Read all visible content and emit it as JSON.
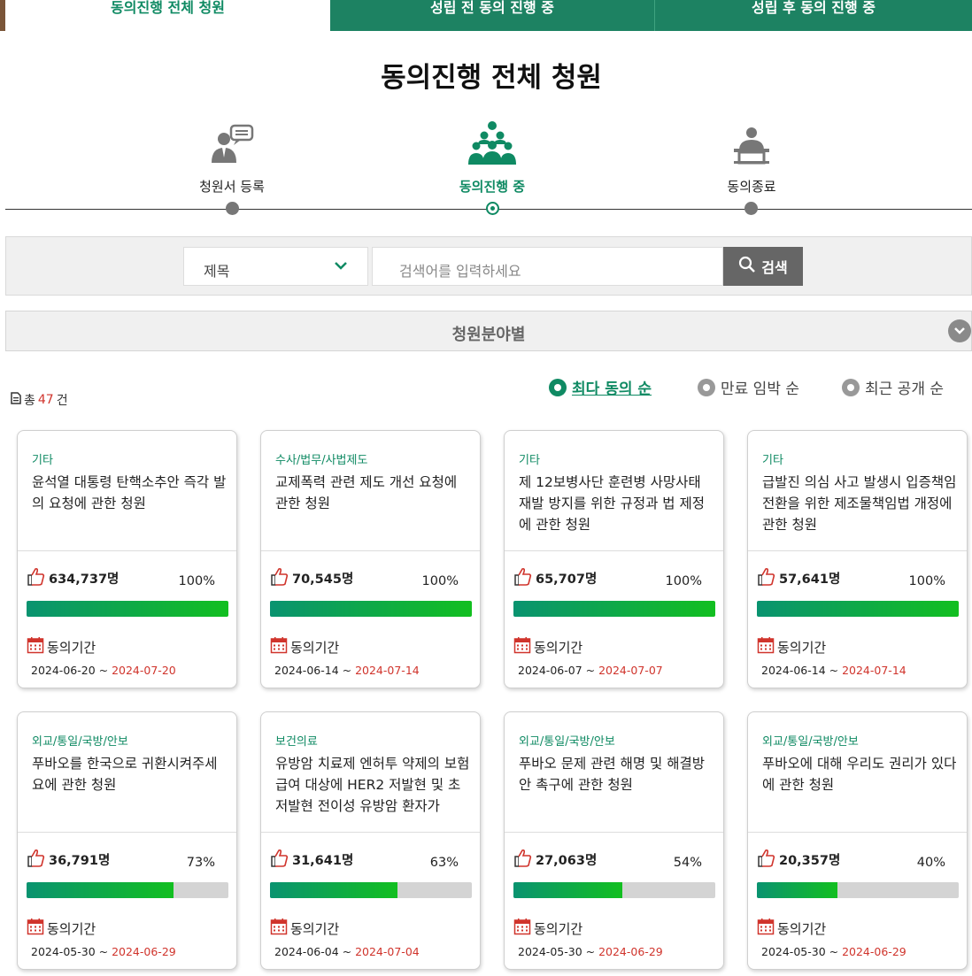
{
  "tabs": [
    {
      "label": "동의진행 전체 청원",
      "active": true
    },
    {
      "label": "성립 전 동의 진행 중",
      "active": false
    },
    {
      "label": "성립 후 동의 진행 중",
      "active": false
    }
  ],
  "page_title": "동의진행 전체 청원",
  "steps": [
    {
      "label": "청원서 등록",
      "icon": "speech-person-icon"
    },
    {
      "label": "동의진행 중",
      "icon": "group-people-icon",
      "active": true
    },
    {
      "label": "동의종료",
      "icon": "podium-person-icon"
    }
  ],
  "search": {
    "select_value": "제목",
    "placeholder": "검색어를 입력하세요",
    "button_label": "검색"
  },
  "field_filter_label": "청원분야별",
  "total": {
    "prefix": "총",
    "count": "47",
    "suffix": "건"
  },
  "sort_options": [
    {
      "label": "최다 동의 순",
      "selected": true
    },
    {
      "label": "만료 임박 순",
      "selected": false
    },
    {
      "label": "최근 공개 순",
      "selected": false
    }
  ],
  "period_label": "동의기간",
  "petitions": [
    {
      "category": "기타",
      "title": "윤석열 대통령 탄핵소추안 즉각 발의 요청에 관한 청원",
      "count": "634,737명",
      "percent": "100%",
      "progress": 1.0,
      "start": "2024-06-20",
      "sep": " ~ ",
      "end": "2024-07-20"
    },
    {
      "category": "수사/법무/사법제도",
      "title": "교제폭력 관련 제도 개선 요청에 관한 청원",
      "count": "70,545명",
      "percent": "100%",
      "progress": 1.0,
      "start": "2024-06-14",
      "sep": " ~ ",
      "end": "2024-07-14"
    },
    {
      "category": "기타",
      "title": "제 12보병사단 훈련병 사망사태 재발 방지를 위한 규정과 법 제정에 관한 청원",
      "count": "65,707명",
      "percent": "100%",
      "progress": 1.0,
      "start": "2024-06-07",
      "sep": " ~ ",
      "end": "2024-07-07"
    },
    {
      "category": "기타",
      "title": "급발진 의심 사고 발생시 입증책임 전환을 위한 제조물책임법 개정에 관한 청원",
      "count": "57,641명",
      "percent": "100%",
      "progress": 1.0,
      "start": "2024-06-14",
      "sep": " ~ ",
      "end": "2024-07-14"
    },
    {
      "category": "외교/통일/국방/안보",
      "title": "푸바오를 한국으로 귀환시켜주세요에 관한 청원",
      "count": "36,791명",
      "percent": "73%",
      "progress": 0.73,
      "start": "2024-05-30",
      "sep": " ~ ",
      "end": "2024-06-29"
    },
    {
      "category": "보건의료",
      "title": "유방암 치료제 엔허투 약제의 보험 급여 대상에 HER2 저발현 및 초저발현 전이성 유방암 환자가",
      "count": "31,641명",
      "percent": "63%",
      "progress": 0.63,
      "start": "2024-06-04",
      "sep": " ~ ",
      "end": "2024-07-04"
    },
    {
      "category": "외교/통일/국방/안보",
      "title": "푸바오 문제 관련 해명 및 해결방안 촉구에 관한 청원",
      "count": "27,063명",
      "percent": "54%",
      "progress": 0.54,
      "start": "2024-05-30",
      "sep": " ~ ",
      "end": "2024-06-29"
    },
    {
      "category": "외교/통일/국방/안보",
      "title": "푸바오에 대해 우리도 권리가 있다에 관한 청원",
      "count": "20,357명",
      "percent": "40%",
      "progress": 0.4,
      "start": "2024-05-30",
      "sep": " ~ ",
      "end": "2024-06-29"
    }
  ],
  "colors": {
    "accent": "#0f8a63",
    "tab_bg": "#1d8262",
    "end_date": "#d0342c"
  }
}
